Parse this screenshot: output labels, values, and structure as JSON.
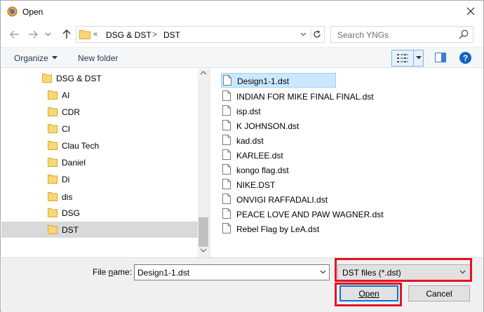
{
  "window": {
    "title": "Open"
  },
  "address": {
    "overflow": "«",
    "crumbs": [
      "DSG & DST",
      "DST"
    ],
    "separator": ">"
  },
  "search": {
    "placeholder": "Search YNGs"
  },
  "toolbar": {
    "organize_label": "Organize",
    "new_folder_label": "New folder"
  },
  "nav": {
    "items": [
      {
        "label": "DSG & DST",
        "level": 0
      },
      {
        "label": "AI",
        "level": 1
      },
      {
        "label": "CDR",
        "level": 1
      },
      {
        "label": "CI",
        "level": 1
      },
      {
        "label": "Clau Tech",
        "level": 1
      },
      {
        "label": "Daniel",
        "level": 1
      },
      {
        "label": "Di",
        "level": 1
      },
      {
        "label": "dis",
        "level": 1
      },
      {
        "label": "DSG",
        "level": 1
      },
      {
        "label": "DST",
        "level": 1,
        "selected": true
      }
    ]
  },
  "files": [
    {
      "name": "Design1-1.dst",
      "selected": true
    },
    {
      "name": "INDIAN FOR MIKE FINAL FINAL.dst"
    },
    {
      "name": "isp.dst"
    },
    {
      "name": "K JOHNSON.dst"
    },
    {
      "name": "kad.dst"
    },
    {
      "name": "KARLEE.dst"
    },
    {
      "name": "kongo flag.dst"
    },
    {
      "name": "NIKE.DST"
    },
    {
      "name": "ONVIGI RAFFADALI.dst"
    },
    {
      "name": "PEACE LOVE AND PAW WAGNER.dst"
    },
    {
      "name": "Rebel Flag by LeA.dst"
    }
  ],
  "bottom": {
    "file_name_label_pre": "File ",
    "file_name_label_u": "n",
    "file_name_label_post": "ame:",
    "file_name_value": "Design1-1.dst",
    "file_type_value": "DST files (*.dst)",
    "open_label": "Open",
    "cancel_label": "Cancel"
  },
  "colors": {
    "highlight_red": "#e81123",
    "selection_blue": "#cce8ff",
    "accent": "#0078d7"
  },
  "icons": {
    "app": "app-icon",
    "close": "close-icon",
    "back": "back-arrow-icon",
    "forward": "forward-arrow-icon",
    "recent": "chevron-down-icon",
    "up": "up-arrow-icon",
    "refresh": "refresh-icon",
    "search": "search-icon",
    "view": "details-view-icon",
    "pane": "preview-pane-icon",
    "help": "help-icon",
    "folder": "folder-icon",
    "file": "file-icon"
  }
}
